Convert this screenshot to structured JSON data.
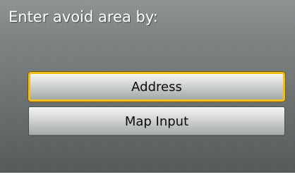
{
  "screen": {
    "title": "Enter avoid area by:"
  },
  "options": [
    {
      "label": "Address",
      "selected": true
    },
    {
      "label": "Map Input",
      "selected": false
    }
  ],
  "colors": {
    "highlight": "#f0bd1c",
    "background": "#737879",
    "title_text": "#ffffff"
  }
}
